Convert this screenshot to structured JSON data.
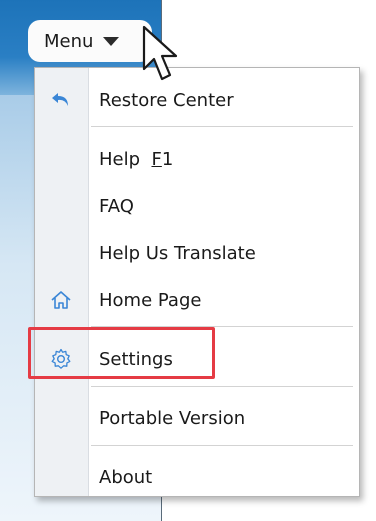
{
  "menu_button": {
    "label": "Menu",
    "caret_icon": "caret-down-icon"
  },
  "menu": {
    "items": [
      {
        "label": "Restore Center",
        "icon": "undo-arrow-icon"
      },
      {
        "label_main": "Help  ",
        "label_shortcut": "F",
        "label_rest": "1",
        "icon": ""
      },
      {
        "label": "FAQ",
        "icon": ""
      },
      {
        "label": "Help Us Translate",
        "icon": ""
      },
      {
        "label": "Home Page",
        "icon": "house-icon"
      },
      {
        "label": "Settings",
        "icon": "gear-icon",
        "highlighted": true
      },
      {
        "label": "Portable Version",
        "icon": ""
      },
      {
        "label": "About",
        "icon": ""
      }
    ]
  },
  "colors": {
    "accent_blue": "#2a7fc4",
    "highlight_red": "#e53b44",
    "icon_blue": "#3a86d6"
  }
}
